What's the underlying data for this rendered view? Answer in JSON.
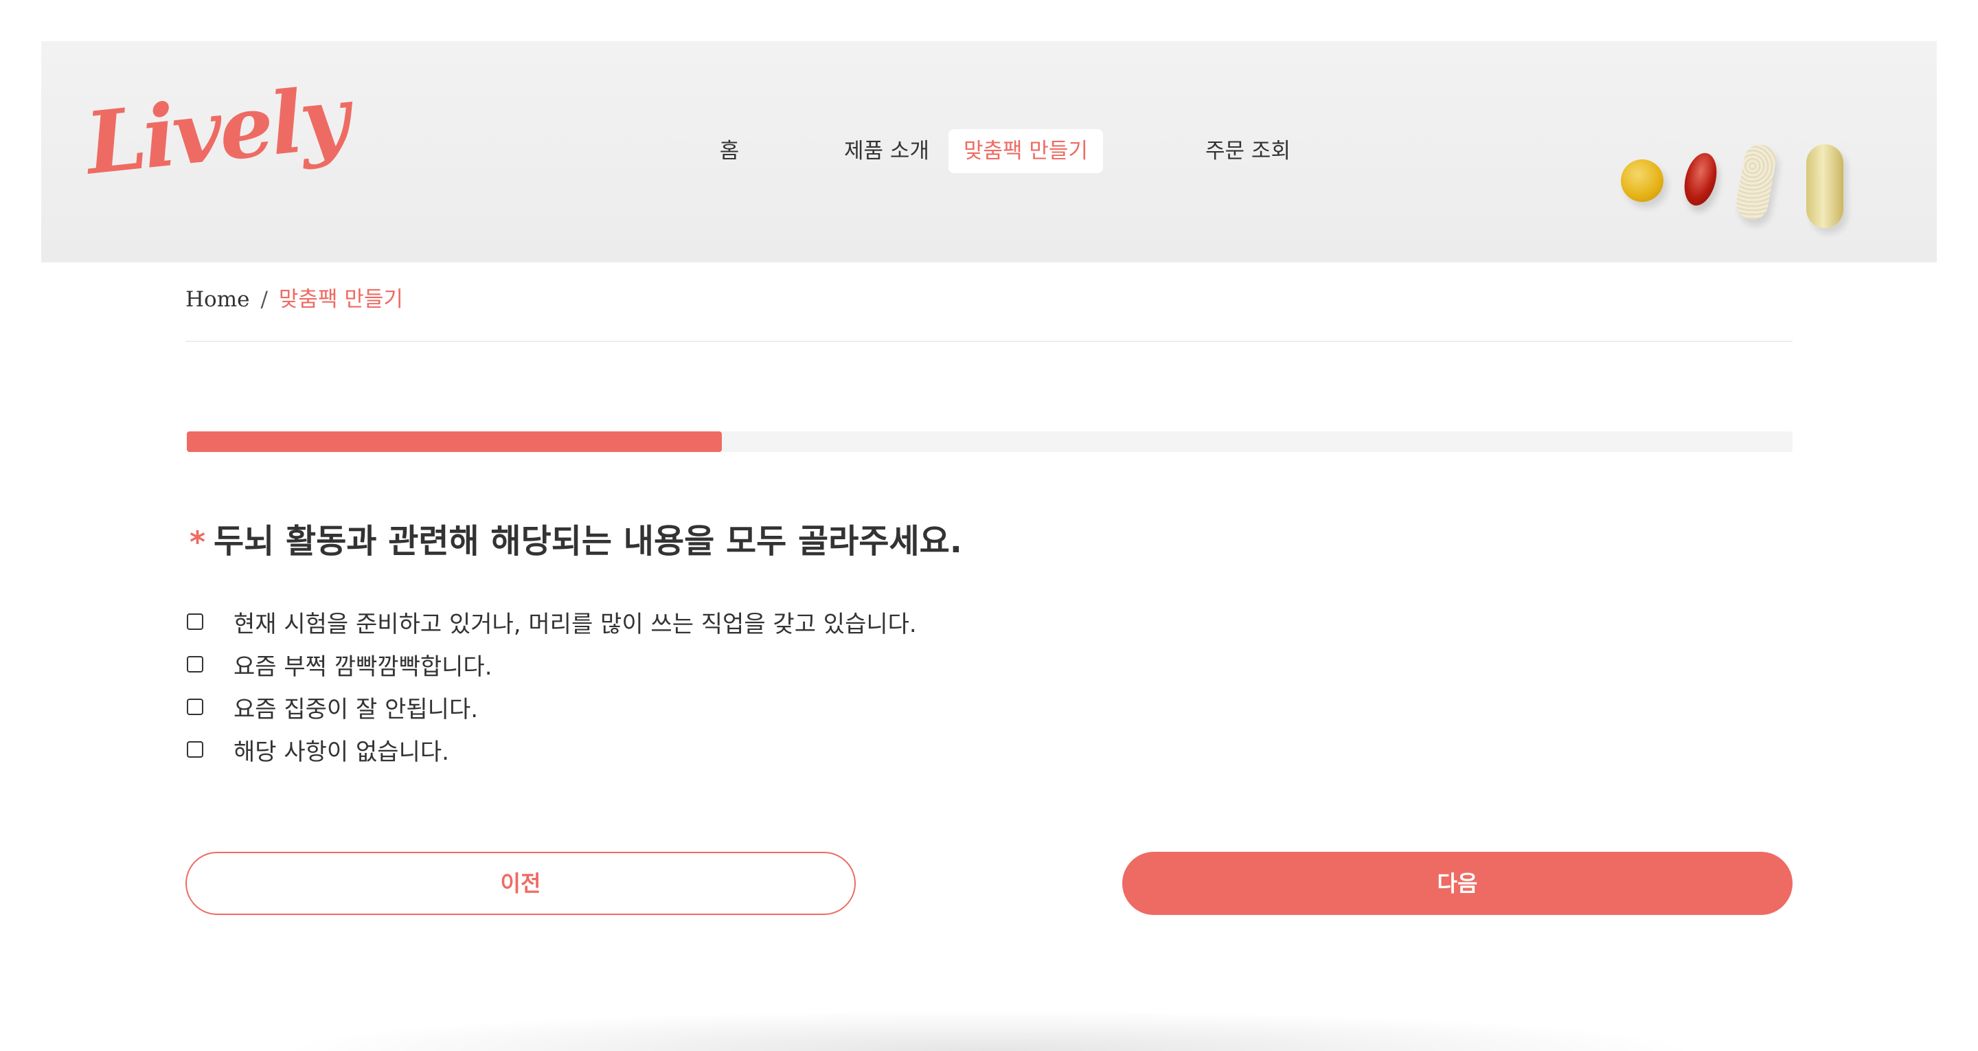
{
  "brand": {
    "logo_text": "Lively",
    "accent_color": "#ee6b63"
  },
  "nav": {
    "items": [
      {
        "label": "홈",
        "active": false
      },
      {
        "label": "제품 소개",
        "active": false
      },
      {
        "label": "맞춤팩 만들기",
        "active": true
      },
      {
        "label": "주문 조회",
        "active": false
      }
    ]
  },
  "header_image": {
    "icon": "supplement-pills-image"
  },
  "breadcrumb": {
    "home": "Home",
    "separator": "/",
    "current": "맞춤팩 만들기"
  },
  "progress": {
    "fraction": 0.333
  },
  "question": {
    "required_mark": "*",
    "text": "두뇌 활동과 관련해 해당되는 내용을 모두 골라주세요."
  },
  "options": [
    {
      "label": "현재 시험을 준비하고 있거나, 머리를 많이 쓰는 직업을 갖고 있습니다.",
      "checked": false
    },
    {
      "label": "요즘 부쩍 깜빡깜빡합니다.",
      "checked": false
    },
    {
      "label": "요즘 집중이 잘 안됩니다.",
      "checked": false
    },
    {
      "label": "해당 사항이 없습니다.",
      "checked": false
    }
  ],
  "buttons": {
    "prev_label": "이전",
    "next_label": "다음"
  }
}
